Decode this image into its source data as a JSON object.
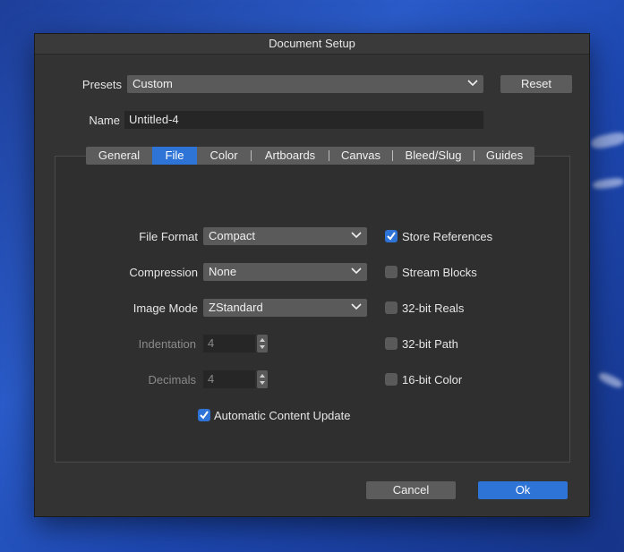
{
  "window": {
    "title": "Document Setup"
  },
  "presets": {
    "label": "Presets",
    "value": "Custom"
  },
  "reset_label": "Reset",
  "name_field": {
    "label": "Name",
    "value": "Untitled-4"
  },
  "tabs": [
    {
      "label": "General",
      "active": false
    },
    {
      "label": "File",
      "active": true
    },
    {
      "label": "Color",
      "active": false
    },
    {
      "label": "Artboards",
      "active": false
    },
    {
      "label": "Canvas",
      "active": false
    },
    {
      "label": "Bleed/Slug",
      "active": false
    },
    {
      "label": "Guides",
      "active": false
    }
  ],
  "file": {
    "file_format": {
      "label": "File Format",
      "value": "Compact"
    },
    "compression": {
      "label": "Compression",
      "value": "None"
    },
    "image_mode": {
      "label": "Image Mode",
      "value": "ZStandard"
    },
    "indentation": {
      "label": "Indentation",
      "value": "4",
      "enabled": false
    },
    "decimals": {
      "label": "Decimals",
      "value": "4",
      "enabled": false
    },
    "checkboxes": [
      {
        "label": "Store References",
        "checked": true
      },
      {
        "label": "Stream Blocks",
        "checked": false
      },
      {
        "label": "32-bit Reals",
        "checked": false
      },
      {
        "label": "32-bit Path",
        "checked": false
      },
      {
        "label": "16-bit Color",
        "checked": false
      }
    ],
    "auto_update": {
      "label": "Automatic Content Update",
      "checked": true
    }
  },
  "footer": {
    "cancel_label": "Cancel",
    "ok_label": "Ok"
  },
  "colors": {
    "accent": "#2e73d6",
    "dialog_bg": "#333333",
    "control_bg": "#5a5a5a"
  }
}
